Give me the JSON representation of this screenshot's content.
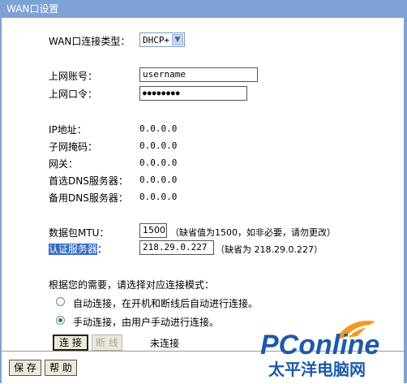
{
  "header": {
    "title": "WAN口设置"
  },
  "form": {
    "wan_type": {
      "label": "WAN口连接类型：",
      "value": "DHCP+"
    },
    "account": {
      "label": "上网账号：",
      "value": "username"
    },
    "password": {
      "label": "上网口令：",
      "value": "●●●●●●●●"
    },
    "ip": {
      "label": "IP地址：",
      "value": "0.0.0.0"
    },
    "mask": {
      "label": "子网掩码：",
      "value": "0.0.0.0"
    },
    "gateway": {
      "label": "网关：",
      "value": "0.0.0.0"
    },
    "dns1": {
      "label": "首选DNS服务器：",
      "value": "0.0.0.0"
    },
    "dns2": {
      "label": "备用DNS服务器：",
      "value": "0.0.0.0"
    },
    "mtu": {
      "label": "数据包MTU：",
      "value": "1500",
      "hint": "（缺省值为1500，如非必要，请勿更改）"
    },
    "auth": {
      "label": "认证服务器",
      "colon": "：",
      "value": "218.29.0.227",
      "hint": "（缺省为 218.29.0.227）"
    },
    "mode_prompt": "根据您的需要，请选择对应连接模式：",
    "mode_auto": "自动连接，在开机和断线后自动进行连接。",
    "mode_manual": "手动连接，由用户手动进行连接。",
    "selected_mode": "manual",
    "connect_btn": "连 接",
    "disconnect_btn": "断 线",
    "status": "未连接"
  },
  "footer": {
    "save": "保 存",
    "help": "帮 助"
  },
  "watermark": {
    "brand": "PConline",
    "cn": "太平洋电脑网"
  },
  "colors": {
    "frame": "#7ea2d6",
    "brand_blue": "#1e5aa8",
    "brand_orange": "#f39a1c",
    "radio_on": "#1b8a2c"
  }
}
